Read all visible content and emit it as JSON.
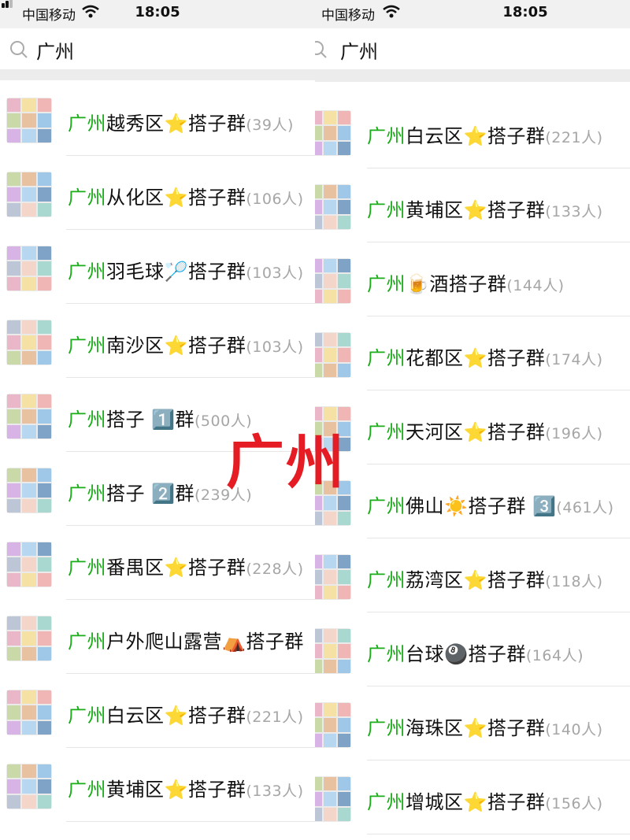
{
  "status_bar": {
    "carrier": "中国移动",
    "time": "18:05"
  },
  "search": {
    "query": "广州"
  },
  "overlay_text": "广州",
  "colors": {
    "keyword": "#1aad19",
    "count": "#a6a6a6",
    "overlay": "#e51c23"
  },
  "left_results": [
    {
      "keyword": "广州",
      "name": "越秀区⭐搭子群",
      "count": "(39人)"
    },
    {
      "keyword": "广州",
      "name": "从化区⭐搭子群",
      "count": "(106人)"
    },
    {
      "keyword": "广州",
      "name": "羽毛球🏸搭子群",
      "count": "(103人)"
    },
    {
      "keyword": "广州",
      "name": "南沙区⭐搭子群",
      "count": "(103人)"
    },
    {
      "keyword": "广州",
      "name": "搭子 1️⃣群",
      "count": "(500人)"
    },
    {
      "keyword": "广州",
      "name": "搭子 2️⃣群",
      "count": "(239人)"
    },
    {
      "keyword": "广州",
      "name": "番禺区⭐搭子群",
      "count": "(228人)"
    },
    {
      "keyword": "广州",
      "name": "户外爬山露营⛺搭子群",
      "count": ""
    },
    {
      "keyword": "广州",
      "name": "白云区⭐搭子群",
      "count": "(221人)"
    },
    {
      "keyword": "广州",
      "name": "黄埔区⭐搭子群",
      "count": "(133人)"
    }
  ],
  "right_results": [
    {
      "keyword": "广州",
      "name": "白云区⭐搭子群",
      "count": "(221人)"
    },
    {
      "keyword": "广州",
      "name": "黄埔区⭐搭子群",
      "count": "(133人)"
    },
    {
      "keyword": "广州",
      "name": "🍺酒搭子群",
      "count": "(144人)"
    },
    {
      "keyword": "广州",
      "name": "花都区⭐搭子群",
      "count": "(174人)"
    },
    {
      "keyword": "广州",
      "name": "天河区⭐搭子群",
      "count": "(196人)"
    },
    {
      "keyword": "广州",
      "name": "佛山☀️搭子群 3️⃣",
      "count": "(461人)"
    },
    {
      "keyword": "广州",
      "name": "荔湾区⭐搭子群",
      "count": "(118人)"
    },
    {
      "keyword": "广州",
      "name": "台球🎱搭子群",
      "count": "(164人)"
    },
    {
      "keyword": "广州",
      "name": "海珠区⭐搭子群",
      "count": "(140人)"
    },
    {
      "keyword": "广州",
      "name": "增城区⭐搭子群",
      "count": "(156人)"
    }
  ]
}
